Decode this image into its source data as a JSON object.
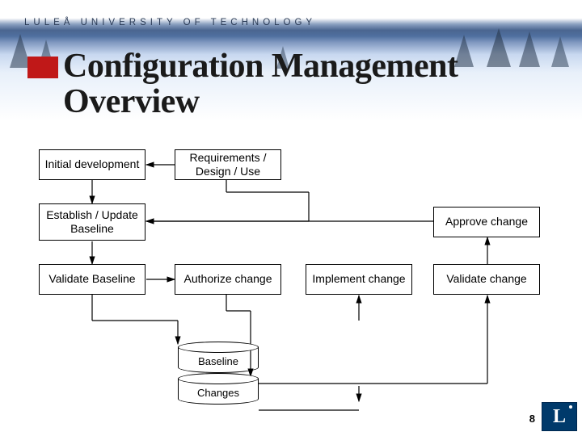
{
  "university": "LULEÅ UNIVERSITY OF TECHNOLOGY",
  "title_line1": "Configuration Management",
  "title_line2": "Overview",
  "boxes": {
    "initial": "Initial development",
    "requirements": "Requirements / Design / Use",
    "establish": "Establish / Update Baseline",
    "approve": "Approve change",
    "validate_baseline": "Validate Baseline",
    "authorize": "Authorize change",
    "implement": "Implement change",
    "validate_change": "Validate change"
  },
  "db": {
    "baseline": "Baseline",
    "changes": "Changes"
  },
  "page_number": "8",
  "logo_letter": "L"
}
